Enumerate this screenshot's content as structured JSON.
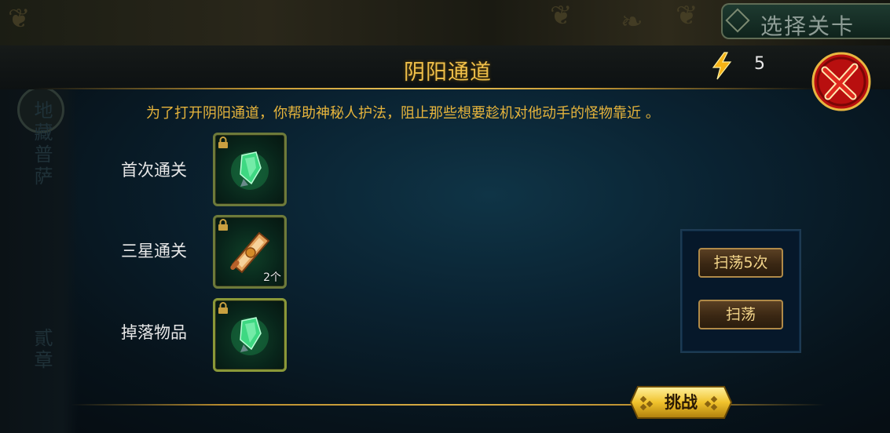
{
  "stage_select": {
    "label": "选择关卡"
  },
  "side_menu": {
    "item_1": "地藏普萨",
    "item_2": "貳章"
  },
  "panel": {
    "title": "阴阳通道",
    "energy_count": "5",
    "description": "为了打开阴阳通道，你帮助神秘人护法，阻止那些想要趁机对他动手的怪物靠近 。"
  },
  "rewards": [
    {
      "label": "首次通关",
      "item_icon": "green-crystal-icon",
      "count": ""
    },
    {
      "label": "三星通关",
      "item_icon": "scroll-icon",
      "count": "2个"
    },
    {
      "label": "掉落物品",
      "item_icon": "green-crystal-icon",
      "count": ""
    }
  ],
  "sweep": {
    "sweep_5_label": "扫荡5次",
    "sweep_label": "扫荡"
  },
  "challenge": {
    "label": "挑战"
  },
  "colors": {
    "accent_gold": "#f0c04a",
    "description_text": "#e6b43c",
    "close_red": "#d41414",
    "slot_border": "#6d7a3a"
  }
}
